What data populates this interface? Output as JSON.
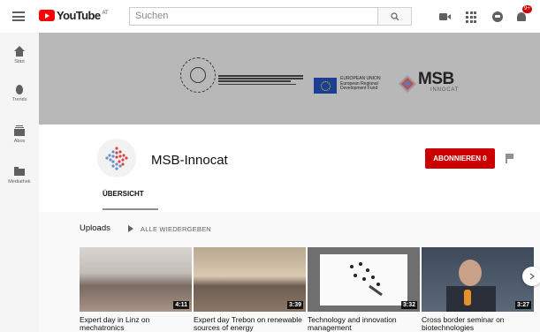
{
  "header": {
    "logo_text": "YouTube",
    "logo_country": "AT",
    "search_placeholder": "Suchen",
    "notification_count": "9+"
  },
  "sidebar": {
    "items": [
      {
        "label": "Start",
        "icon": "home-icon"
      },
      {
        "label": "Trends",
        "icon": "trending-icon"
      },
      {
        "label": "Abos",
        "icon": "subscriptions-icon"
      },
      {
        "label": "Mediathek",
        "icon": "library-icon"
      }
    ]
  },
  "banner": {
    "eu_text_1": "EUROPEAN UNION",
    "eu_text_2": "European Regional",
    "eu_text_3": "Development Fund",
    "msb_name": "MSB",
    "msb_sub": "INNOCAT"
  },
  "channel": {
    "name": "MSB-Innocat",
    "subscribe_label": "ABONNIEREN 0",
    "tabs": [
      {
        "label": "ÜBERSICHT",
        "active": true
      }
    ]
  },
  "uploads": {
    "label": "Uploads",
    "play_all": "ALLE WIEDERGEBEN",
    "videos": [
      {
        "title": "Expert day in Linz on mechatronics",
        "duration": "4:11"
      },
      {
        "title": "Expert day Trebon on renewable sources of energy",
        "duration": "3:39"
      },
      {
        "title": "Technology and innovation management",
        "duration": "3:32"
      },
      {
        "title": "Cross border seminar on biotechnologies",
        "duration": "3:27"
      }
    ]
  },
  "colors": {
    "brand_red": "#ff0000",
    "subscribe_red": "#cc0000",
    "banner_gray": "#b8b8b8"
  }
}
